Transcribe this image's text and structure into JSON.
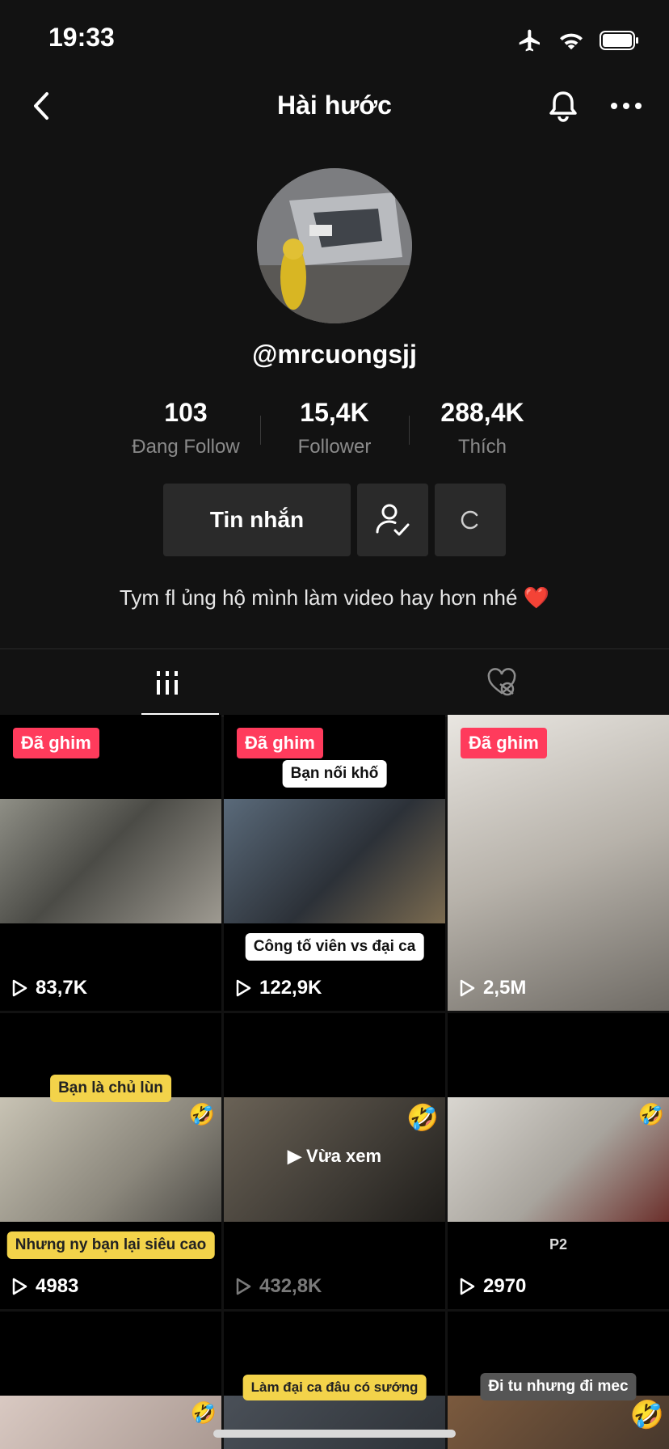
{
  "status_bar": {
    "time": "19:33",
    "icons": [
      "airplane-icon",
      "wifi-icon",
      "battery-icon"
    ]
  },
  "nav": {
    "title": "Hài hước",
    "icons": [
      "chevron-left-icon",
      "bell-icon",
      "more-icon"
    ]
  },
  "profile": {
    "username": "@mrcuongsjj",
    "stats": [
      {
        "value": "103",
        "label": "Đang Follow"
      },
      {
        "value": "15,4K",
        "label": "Follower"
      },
      {
        "value": "288,4K",
        "label": "Thích"
      }
    ],
    "message_button": "Tin nhắn",
    "bio": "Tym fl ủng hộ mình làm video hay hơn nhé ❤️"
  },
  "tabs": [
    "grid-icon",
    "heart-slash-icon"
  ],
  "videos": [
    {
      "pinned_label": "Đã ghim",
      "views": "83,7K",
      "captions": []
    },
    {
      "pinned_label": "Đã ghim",
      "views": "122,9K",
      "captions": [
        "Bạn nối khố",
        "Công tố viên vs đại ca"
      ]
    },
    {
      "pinned_label": "Đã ghim",
      "views": "2,5M",
      "captions": []
    },
    {
      "views": "4983",
      "captions": [
        "Bạn là chủ lùn",
        "Nhưng ny bạn lại siêu cao"
      ]
    },
    {
      "views": "432,8K",
      "overlay": "▶ Vừa xem",
      "captions": []
    },
    {
      "views": "2970",
      "captions": [
        "P2"
      ]
    },
    {
      "views": "",
      "captions": []
    },
    {
      "views": "",
      "captions": [
        "Làm đại ca đâu có sướng"
      ]
    },
    {
      "views": "",
      "captions": [
        "Đi tu nhưng đi mec"
      ]
    }
  ],
  "colors": {
    "background": "#121212",
    "pinned_badge": "#ff3b5c",
    "button_bg": "#2a2a2a"
  }
}
